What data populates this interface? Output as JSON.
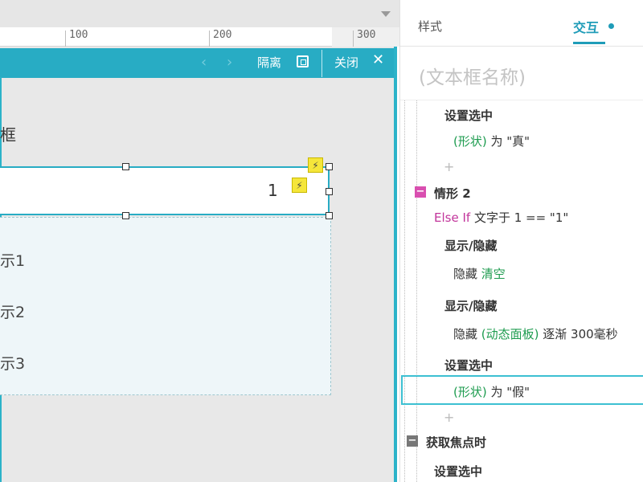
{
  "ruler": {
    "marks": [
      "100",
      "200",
      "300"
    ]
  },
  "isolation_bar": {
    "prev": "‹",
    "next": "›",
    "isolate": "隔离",
    "close": "关闭",
    "close_x": "✕"
  },
  "canvas": {
    "widget_label": "框",
    "textbox_value": "1",
    "options": [
      "示1",
      "示2",
      "示3"
    ]
  },
  "panel": {
    "tabs": {
      "style": "样式",
      "interaction": "交互"
    },
    "name_placeholder": "(文本框名称)",
    "lines": {
      "set_selected_1": "设置选中",
      "shape_true_shape": "(形状)",
      "shape_true_rest": " 为 \"真\"",
      "plus": "+",
      "case2_toggle": "−",
      "case2": "情形 2",
      "else_if": "Else If",
      "else_if_rest": " 文字于 1 == \"1\"",
      "show_hide_1": "显示/隐藏",
      "hide_clear_verb": "隐藏 ",
      "hide_clear_target": "清空",
      "show_hide_2": "显示/隐藏",
      "hide_panel_verb": "隐藏 ",
      "hide_panel_target": "(动态面板)",
      "hide_panel_rest": " 逐渐 300毫秒",
      "set_selected_2": "设置选中",
      "shape_false_shape": "(形状)",
      "shape_false_rest": " 为 \"假\"",
      "on_focus_toggle": "−",
      "on_focus": "获取焦点时",
      "set_selected_3": "设置选中"
    }
  },
  "colors": {
    "accent": "#28acc4",
    "bolt": "#f5e63a",
    "green": "#1c9b4e",
    "pink": "#c2359b"
  }
}
